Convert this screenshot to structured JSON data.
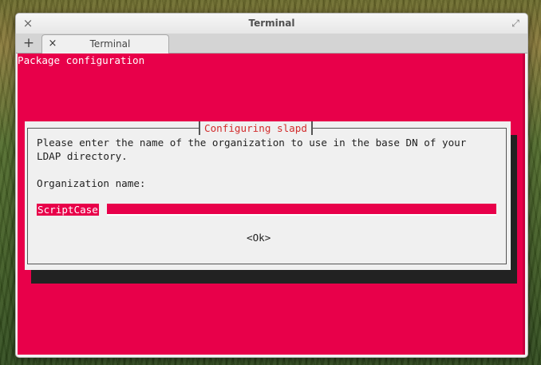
{
  "window": {
    "title": "Terminal",
    "close_glyph": "×",
    "maximize_glyph": "⤢"
  },
  "tabs": {
    "add_glyph": "+",
    "items": [
      {
        "label": "Terminal",
        "close_glyph": "×"
      }
    ]
  },
  "terminal": {
    "header": "Package configuration",
    "background_color": "#e8004a",
    "dialog": {
      "title": "Configuring slapd",
      "message_line1": "Please enter the name of the organization to use in the base DN of your",
      "message_line2": "LDAP directory.",
      "field_label": "Organization name:",
      "field_value": "ScriptCase",
      "ok_label": "<Ok>"
    }
  },
  "icons": {
    "window_close": "close-icon",
    "window_maximize": "maximize-icon",
    "tab_add": "plus-icon",
    "tab_close": "close-icon"
  }
}
